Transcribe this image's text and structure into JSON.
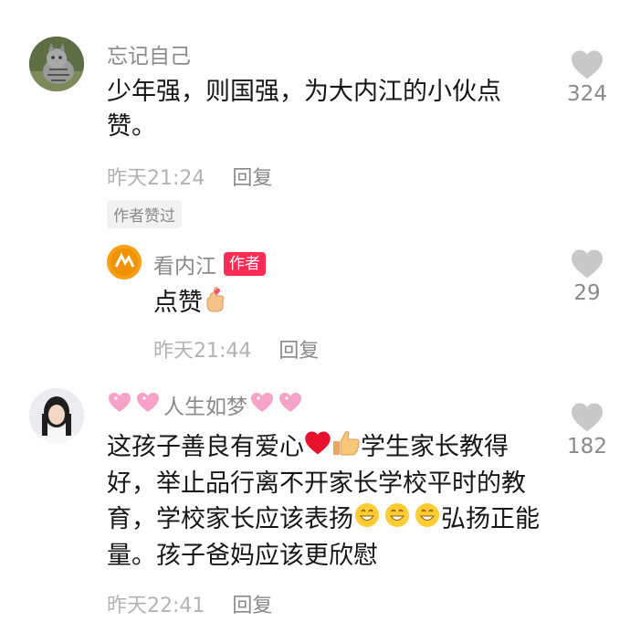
{
  "comments": [
    {
      "username": "忘记自己",
      "content": "少年强，则国强，为大内江的小伙点赞。",
      "time": "昨天21:24",
      "reply_label": "回复",
      "likes": "324",
      "liked_by_author_tag": "作者赞过"
    },
    {
      "username": "看内江",
      "author_badge": "作者",
      "content": "点赞",
      "time": "昨天21:44",
      "reply_label": "回复",
      "likes": "29"
    },
    {
      "username": "人生如梦",
      "content_part1": "这孩子善良有爱心",
      "content_part2": "学生家长教得好，举止品行离不开家长学校平时的教育，学校家长应该表扬",
      "content_part3": "弘扬正能量。孩子爸妈应该更欣慰",
      "time": "昨天22:41",
      "reply_label": "回复",
      "likes": "182"
    }
  ],
  "colors": {
    "author_badge": "#fe2c55",
    "secondary_text": "#8a8a8a",
    "heart": "#c8c8c8"
  }
}
